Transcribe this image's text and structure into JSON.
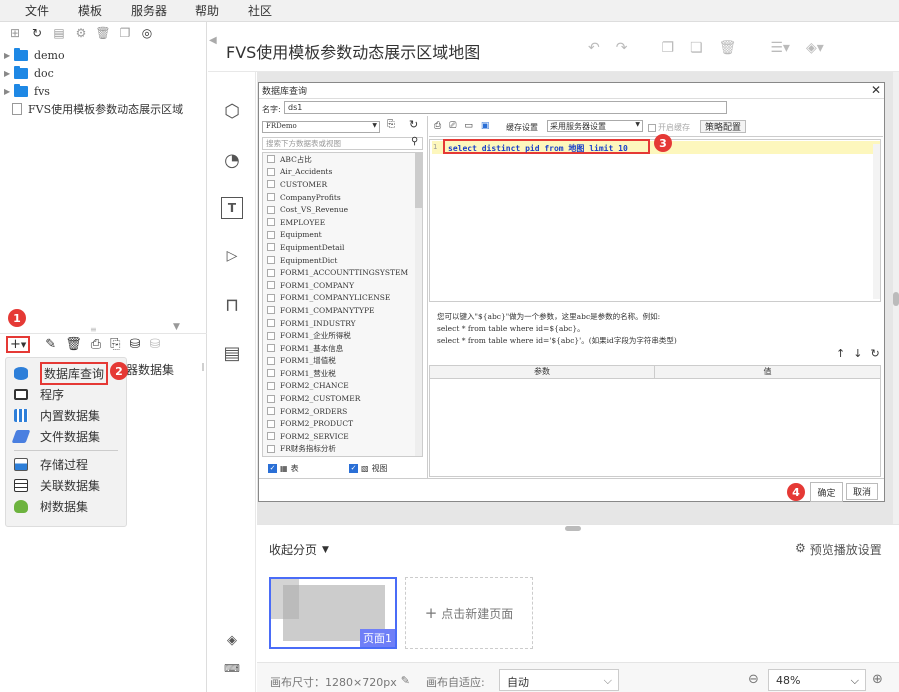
{
  "menubar": [
    "文件",
    "模板",
    "服务器",
    "帮助",
    "社区"
  ],
  "tree": {
    "items": [
      {
        "label": "demo",
        "type": "folder"
      },
      {
        "label": "doc",
        "type": "folder"
      },
      {
        "label": "fvs",
        "type": "folder"
      },
      {
        "label": "FVS使用模板参数动态展示区域",
        "type": "file"
      }
    ]
  },
  "ds_toolbar": {
    "add_label": "+",
    "badge1": "1"
  },
  "ds_menu": {
    "items": [
      {
        "label": "数据库查询",
        "icon": "database-icon"
      },
      {
        "label": "程序",
        "icon": "monitor-icon"
      },
      {
        "label": "内置数据集",
        "icon": "builtin-icon"
      },
      {
        "label": "文件数据集",
        "icon": "file-dataset-icon"
      },
      {
        "label": "存储过程",
        "icon": "stored-proc-icon"
      },
      {
        "label": "关联数据集",
        "icon": "relation-icon"
      },
      {
        "label": "树数据集",
        "icon": "tree-icon"
      }
    ],
    "badge2": "2",
    "server_ds_label": "器数据集"
  },
  "header": {
    "title": "FVS使用模板参数动态展示区域地图"
  },
  "dialog": {
    "title": "数据库查询",
    "name_label": "名字:",
    "name_value": "ds1",
    "connection": "FRDemo",
    "search_placeholder": "搜索下方数据表或视图",
    "tables": [
      "ABC占比",
      "Air_Accidents",
      "CUSTOMER",
      "CompanyProfits",
      "Cost_VS_Revenue",
      "EMPLOYEE",
      "Equipment",
      "EquipmentDetail",
      "EquipmentDict",
      "FORM1_ACCOUNTTINGSYSTEM",
      "FORM1_COMPANY",
      "FORM1_COMPANYLICENSE",
      "FORM1_COMPANYTYPE",
      "FORM1_INDUSTRY",
      "FORM1_企业所得税",
      "FORM1_基本信息",
      "FORM1_增值税",
      "FORM1_营业税",
      "FORM2_CHANCE",
      "FORM2_CUSTOMER",
      "FORM2_ORDERS",
      "FORM2_PRODUCT",
      "FORM2_SERVICE",
      "FR财务指标分析"
    ],
    "check_table": "表",
    "check_view": "视图",
    "cache_label": "缓存设置",
    "cache_select": "采用服务器设置",
    "open_cache": "开启缓存",
    "strategy": "策略配置",
    "line_no": "1",
    "sql": "select distinct pid from 地图 limit 10",
    "badge3": "3",
    "hint1": "您可以键入\"${abc}\"做为一个参数，这里abc是参数的名称。例如:",
    "hint2": "select * from table where id=${abc}。",
    "hint3": "select * from table where id='${abc}'。(如果id字段为字符串类型)",
    "col_param": "参数",
    "col_value": "值",
    "ok": "确定",
    "cancel": "取消",
    "badge4": "4"
  },
  "pages": {
    "collapse_label": "收起分页",
    "preview_settings": "预览播放设置",
    "page1": "页面1",
    "new_page": "点击新建页面"
  },
  "status": {
    "canvas_size": "画布尺寸：1280×720px",
    "adapt_label": "画布自适应:",
    "adapt_value": "自动",
    "zoom": "48%"
  }
}
